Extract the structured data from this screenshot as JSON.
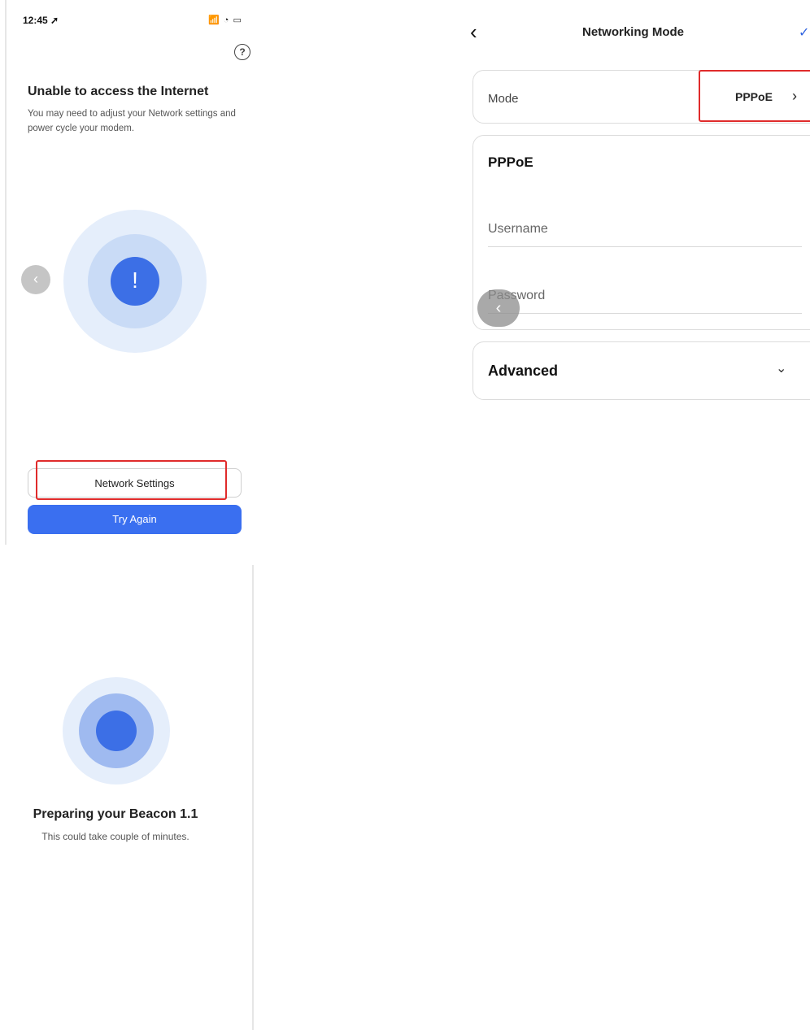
{
  "screen1": {
    "status_time": "12:45 ➚",
    "status_icons": "📶 ◔ ▭",
    "help_icon": "?",
    "title": "Unable to access the Internet",
    "description": "You may need to adjust your Network settings and power cycle your modem.",
    "alert_glyph": "!",
    "back_glyph": "‹",
    "network_settings_label": "Network Settings",
    "try_again_label": "Try Again"
  },
  "screen2": {
    "back_glyph": "‹",
    "title": "Networking Mode",
    "check_glyph": "✓",
    "mode_label": "Mode",
    "mode_value": "PPPoE",
    "mode_chevron": "›",
    "section_title": "PPPoE",
    "username_label": "Username",
    "password_label": "Password",
    "back_glyph2": "‹",
    "advanced_label": "Advanced",
    "advanced_chevron": "⌄"
  },
  "screen3": {
    "title": "Preparing your Beacon 1.1",
    "subtitle": "This could take couple of minutes."
  },
  "colors": {
    "accent": "#3a6ff0",
    "highlight": "#e02b2b"
  }
}
